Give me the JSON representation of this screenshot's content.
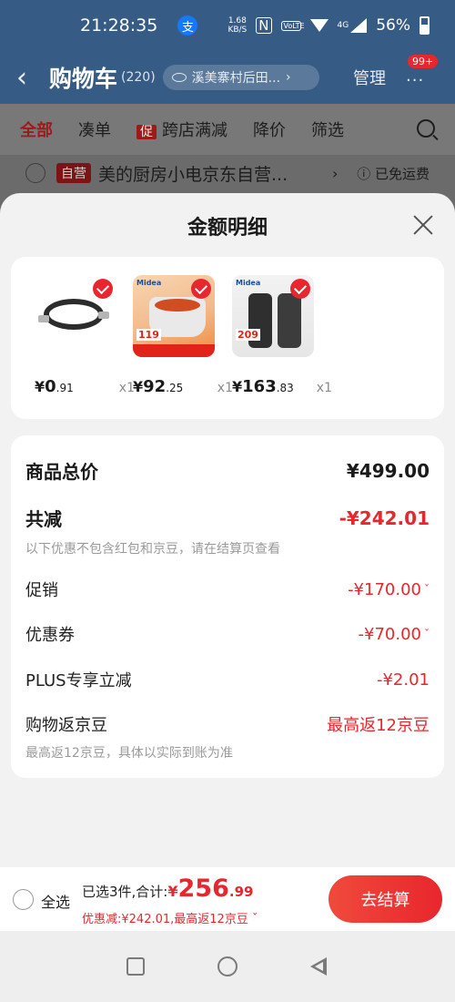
{
  "status_bar": {
    "time": "21:28:35",
    "net_speed_value": "1.68",
    "net_speed_unit": "KB/S",
    "volte": "VoLTE",
    "signal_type": "4G",
    "battery": "56%",
    "icons": [
      "alipay-icon",
      "nfc-icon",
      "volte-icon",
      "wifi-icon",
      "cell-signal-icon",
      "battery-icon"
    ]
  },
  "cart_header": {
    "title": "购物车",
    "count": "(220)",
    "location": "溪美寨村后田...",
    "location_chevron": "›",
    "manage": "管理",
    "badge": "99+",
    "more": "···"
  },
  "filter_bar": {
    "tabs": [
      {
        "label": "全部"
      },
      {
        "label": "凑单"
      },
      {
        "label": "跨店满减",
        "tag": "促"
      },
      {
        "label": "降价"
      },
      {
        "label": "筛选"
      }
    ]
  },
  "store_row": {
    "tag": "自营",
    "name": "美的厨房小电京东自营...",
    "chevron": "›",
    "shipping": "ⓘ 已免运费"
  },
  "sheet": {
    "title": "金额明细",
    "products": [
      {
        "name": "hose",
        "yen": "¥",
        "price_int": "0",
        "price_dec": ".91",
        "qty": "x1"
      },
      {
        "name": "electric-cooker",
        "yen": "¥",
        "price_int": "92",
        "price_dec": ".25",
        "qty": "x1",
        "thumb_price": "119",
        "brand": "Midea"
      },
      {
        "name": "blender",
        "yen": "¥",
        "price_int": "163",
        "price_dec": ".83",
        "qty": "x1",
        "thumb_price": "209",
        "brand": "Midea"
      }
    ],
    "details": {
      "total_label": "商品总价",
      "total_value": "¥499.00",
      "reduce_label": "共减",
      "reduce_value": "-¥242.01",
      "reduce_note": "以下优惠不包含红包和京豆，请在结算页查看",
      "promo_label": "促销",
      "promo_value": "-¥170.00",
      "coupon_label": "优惠券",
      "coupon_value": "-¥70.00",
      "plus_label": "PLUS专享立减",
      "plus_value": "-¥2.01",
      "beans_label": "购物返京豆",
      "beans_value": "最高返12京豆",
      "beans_note": "最高返12京豆，具体以实际到账为准",
      "chevron": "ˇ"
    }
  },
  "checkout": {
    "select_all": "全选",
    "selected_text": "已选3件,合计:",
    "yen": "¥",
    "total_int": "256",
    "total_dec": ".99",
    "discount_text": "优惠减:¥242.01,最高返12京豆 ˇ",
    "button": "去结算"
  },
  "colors": {
    "accent_red": "#e8262d",
    "header_blue": "#365c85",
    "sheet_bg": "#f2f2f2"
  }
}
